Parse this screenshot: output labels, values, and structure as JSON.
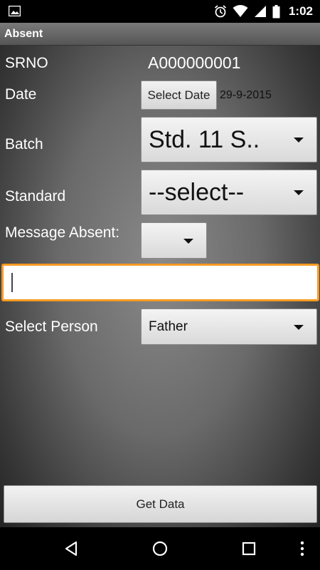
{
  "status_bar": {
    "time": "1:02"
  },
  "title_bar": {
    "title": "Absent"
  },
  "form": {
    "srno_label": "SRNO",
    "srno_value": "A000000001",
    "date_label": "Date",
    "select_date_button": "Select Date",
    "date_value": "29-9-2015",
    "batch_label": "Batch",
    "batch_selected": "Std. 11 S..",
    "standard_label": "Standard",
    "standard_selected": "--select--",
    "message_label": "Message Absent:",
    "message_selected": "",
    "text_input_value": "",
    "person_label": "Select Person",
    "person_selected": "Father"
  },
  "get_data_button": "Get Data",
  "colors": {
    "focus_border": "#f59a23",
    "title_bar": "#6a6a6a"
  }
}
